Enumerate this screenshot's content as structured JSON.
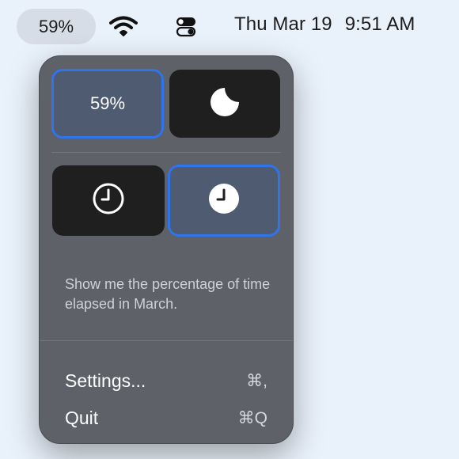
{
  "menubar": {
    "percent_label": "59%",
    "wifi_icon": "wifi-icon",
    "control_center_icon": "control-center-icon",
    "date": "Thu Mar 19",
    "time": "9:51 AM"
  },
  "popover": {
    "tiles": [
      {
        "label": "59%",
        "state": "selected"
      },
      {
        "icon": "moon-icon",
        "state": "unselected"
      },
      {
        "icon": "clock-outline-icon",
        "state": "unselected"
      },
      {
        "icon": "clock-filled-icon",
        "state": "selected"
      }
    ],
    "description": "Show me the percentage of time elapsed in March.",
    "menu": [
      {
        "label": "Settings...",
        "shortcut": "⌘,"
      },
      {
        "label": "Quit",
        "shortcut": "⌘Q"
      }
    ]
  },
  "colors": {
    "accent": "#2f74ea",
    "popover_bg": "#5f6168",
    "tile_dark": "#1f1f20",
    "tile_selected": "#4f5b70",
    "desktop_bg": "#e9f1fb"
  }
}
